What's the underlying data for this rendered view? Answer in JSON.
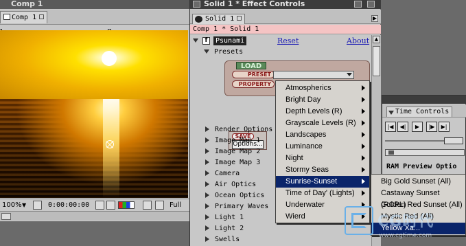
{
  "comp_window": {
    "title": "Comp 1",
    "tab_label": "Comp 1",
    "zoom": "100%",
    "timecode": "0:00:00:00",
    "resolution": "Full"
  },
  "effect_controls": {
    "title": "Solid 1 * Effect Controls",
    "tab_label": "Solid 1",
    "breadcrumb": "Comp 1 * Solid 1",
    "effect": {
      "check": "f",
      "name": "Psunami",
      "reset": "Reset",
      "about": "About"
    },
    "presets_label": "Presets",
    "load_label": "LOAD",
    "preset_label": "PRESET",
    "property_label": "PROPERTY",
    "save_label": "SAVE",
    "options_label": "Options...",
    "params": [
      "Render Options",
      "Image Map 1",
      "Image Map 2",
      "Image Map 3",
      "Camera",
      "Air Optics",
      "Ocean Optics",
      "Primary Waves",
      "Light 1",
      "Light 2",
      "Swells"
    ]
  },
  "preset_menu": {
    "items": [
      {
        "label": "Atmospherics",
        "submenu": true,
        "selected": false
      },
      {
        "label": "Bright Day",
        "submenu": true,
        "selected": false
      },
      {
        "label": "Depth Levels (R)",
        "submenu": true,
        "selected": false
      },
      {
        "label": "Grayscale Levels (R)",
        "submenu": true,
        "selected": false
      },
      {
        "label": "Landscapes",
        "submenu": true,
        "selected": false
      },
      {
        "label": "Luminance",
        "submenu": true,
        "selected": false
      },
      {
        "label": "Night",
        "submenu": true,
        "selected": false
      },
      {
        "label": "Stormy Seas",
        "submenu": true,
        "selected": false
      },
      {
        "label": "Sunrise-Sunset",
        "submenu": true,
        "selected": true
      },
      {
        "label": "Time of Day' (Lights)",
        "submenu": true,
        "selected": false
      },
      {
        "label": "Underwater",
        "submenu": true,
        "selected": false
      },
      {
        "label": "Wierd",
        "submenu": true,
        "selected": false
      }
    ]
  },
  "sunset_submenu": {
    "items": [
      {
        "label": "Big Gold Sunset (All)",
        "selected": false
      },
      {
        "label": "Castaway Sunset (RCPL)",
        "selected": false
      },
      {
        "label": "Golden Red Sunset (All)",
        "selected": false
      },
      {
        "label": "Mystic Red (All)",
        "selected": false
      },
      {
        "label": "Yellow Xa...",
        "selected": true
      }
    ]
  },
  "time_controls": {
    "title": "Time Controls",
    "ram_preview": "RAM Preview Optio"
  },
  "watermark": {
    "text": "CG时代",
    "url": "www.cgtime.com"
  },
  "colors": {
    "menu_bg": "#d6d3ce",
    "menu_selected": "#0a246a",
    "breadcrumb_bg": "#f5c4c4",
    "link": "#1a1ab4"
  }
}
